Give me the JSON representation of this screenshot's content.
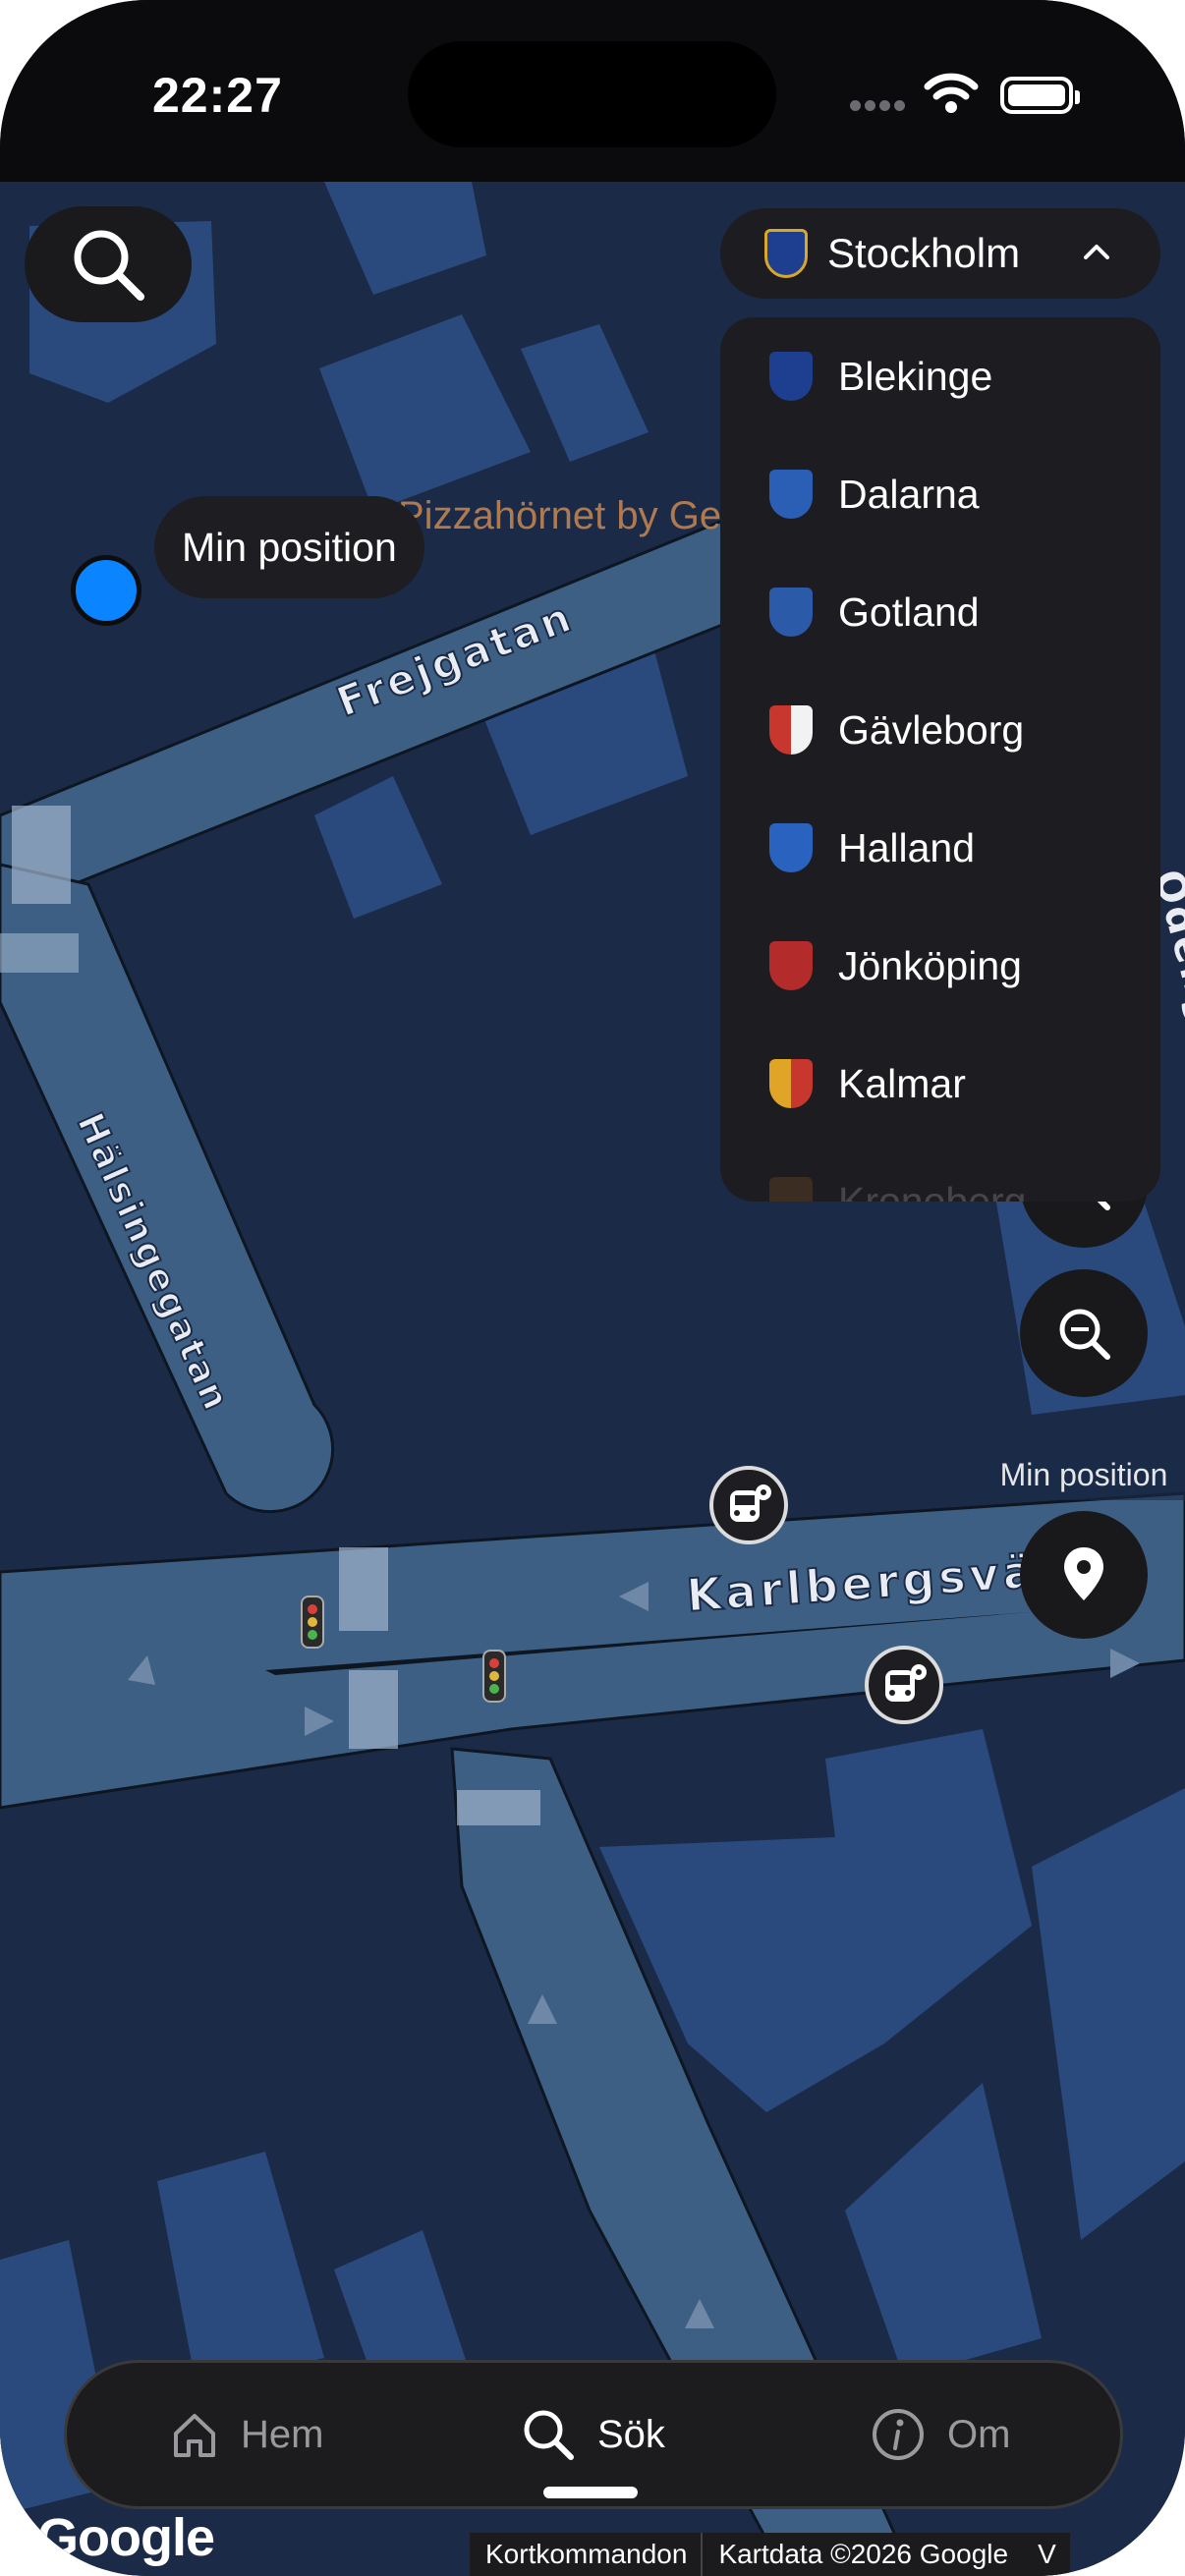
{
  "status_bar": {
    "time": "22:27"
  },
  "map": {
    "street_labels": [
      "Frejgatan",
      "Hälsingegatan",
      "Karlbergsväger",
      "Odeng"
    ],
    "poi_label": "Pizzahörnet by Ge",
    "my_location_tooltip": "Min position"
  },
  "region_selector": {
    "selected": "Stockholm",
    "options": [
      {
        "name": "Blekinge",
        "crest_icon": "blekinge-crest-icon",
        "color": "#1e3f8f"
      },
      {
        "name": "Dalarna",
        "crest_icon": "dalarna-crest-icon",
        "color": "#2a5fb5"
      },
      {
        "name": "Gotland",
        "crest_icon": "gotland-crest-icon",
        "color": "#2b5aa8"
      },
      {
        "name": "Gävleborg",
        "crest_icon": "gavleborg-crest-icon",
        "color": "#c8372d"
      },
      {
        "name": "Halland",
        "crest_icon": "halland-crest-icon",
        "color": "#2a62c0"
      },
      {
        "name": "Jönköping",
        "crest_icon": "jonkoping-crest-icon",
        "color": "#b42b2b"
      },
      {
        "name": "Kalmar",
        "crest_icon": "kalmar-crest-icon",
        "color": "#e0a526"
      },
      {
        "name": "Kronoberg",
        "crest_icon": "kronoberg-crest-icon",
        "color": "#c97a2b"
      }
    ]
  },
  "map_controls": {
    "zoom_out_icon": "zoom-out-icon",
    "my_position_label": "Min position"
  },
  "tab_bar": {
    "tabs": [
      {
        "label": "Hem",
        "icon": "home-icon"
      },
      {
        "label": "Sök",
        "icon": "search-icon",
        "active": true
      },
      {
        "label": "Om",
        "icon": "info-icon"
      }
    ]
  },
  "attribution": {
    "google": "Google",
    "shortcuts": "Kortkommandon",
    "map_data": "Kartdata ©2026 Google",
    "terms": "V"
  },
  "colors": {
    "map_background": "#1b2b47",
    "road": "#3e5f84",
    "building": "#2a4a7d",
    "location_dot": "#0a84ff"
  }
}
